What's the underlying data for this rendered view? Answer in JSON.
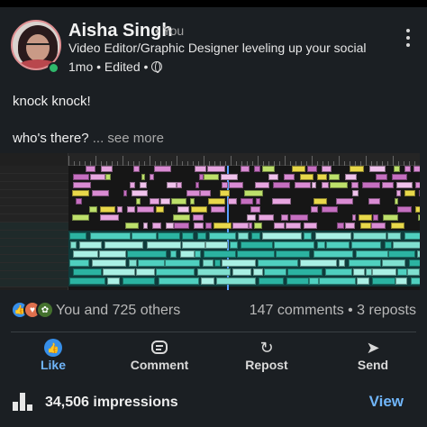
{
  "author": {
    "name": "Aisha Singh",
    "relation": "• You",
    "headline": "Video Editor/Graphic Designer leveling up your social ...",
    "meta": "1mo • Edited •",
    "avatar_icon": "profile-photo",
    "online_color": "#2fb86b"
  },
  "post": {
    "line1": "knock knock!",
    "line2": "who's there?",
    "see_more": "... see more",
    "image_description": "video-editing-timeline-screenshot"
  },
  "social": {
    "reaction_icons": [
      "like-icon",
      "love-icon",
      "support-icon"
    ],
    "reactions_text": "You and 725 others",
    "comments_reposts": "147 comments • 3 reposts"
  },
  "actions": [
    {
      "label": "Like",
      "icon": "thumbs-up-icon"
    },
    {
      "label": "Comment",
      "icon": "comment-icon"
    },
    {
      "label": "Repost",
      "icon": "repost-icon"
    },
    {
      "label": "Send",
      "icon": "send-icon"
    }
  ],
  "footer": {
    "impressions": "34,506 impressions",
    "view_label": "View"
  },
  "colors": {
    "background": "#1b1f23",
    "accent": "#70b5f9",
    "like_blue": "#378fe9"
  }
}
